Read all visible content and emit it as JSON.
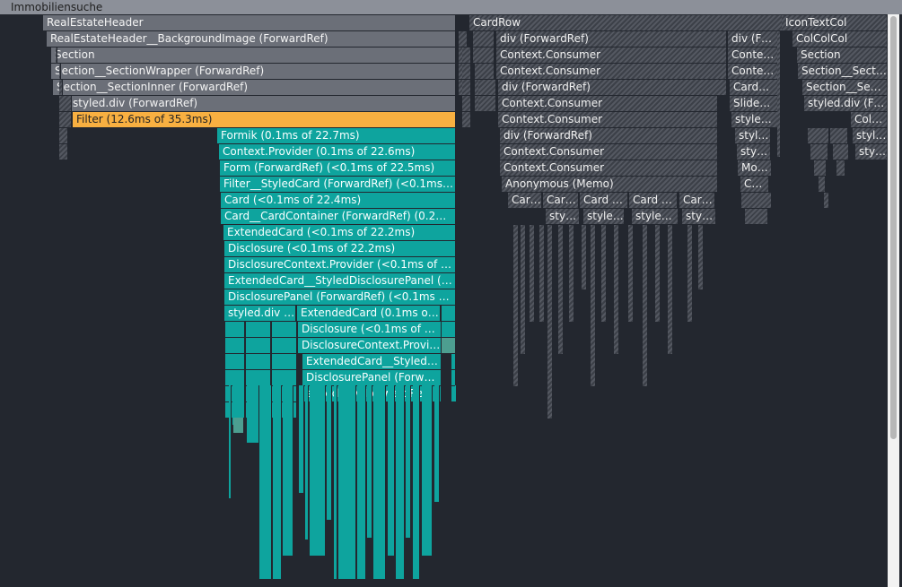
{
  "root": {
    "label": "Immobiliensuche"
  },
  "colors": {
    "selected": "#f8b041",
    "render": "#0ea49e",
    "inactive": "#6b6f78",
    "background": "#23272f"
  },
  "left_stack": [
    {
      "label": "RealEstateHeader"
    },
    {
      "label": "RealEstateHeader__BackgroundImage (ForwardRef)"
    },
    {
      "label": "Section"
    },
    {
      "label": "Section__SectionWrapper (ForwardRef)"
    },
    {
      "label": "Section__SectionInner (ForwardRef)"
    },
    {
      "label": "styled.div (ForwardRef)"
    },
    {
      "label": "Filter (12.6ms of 35.3ms)"
    }
  ],
  "render_stack": [
    {
      "label": "Formik (0.1ms of 22.7ms)"
    },
    {
      "label": "Context.Provider (0.1ms of 22.6ms)"
    },
    {
      "label": "Form (ForwardRef) (<0.1ms of 22.5ms)"
    },
    {
      "label": "Filter__StyledCard (ForwardRef) (<0.1ms of…"
    },
    {
      "label": "Card (<0.1ms of 22.4ms)"
    },
    {
      "label": "Card__CardContainer (ForwardRef) (0.2ms…"
    },
    {
      "label": "ExtendedCard (<0.1ms of 22.2ms)"
    },
    {
      "label": "Disclosure (<0.1ms of 22.2ms)"
    },
    {
      "label": "DisclosureContext.Provider (<0.1ms of 22.…"
    },
    {
      "label": "ExtendedCard__StyledDisclosurePanel (F…"
    },
    {
      "label": "DisclosurePanel (ForwardRef) (<0.1ms of …"
    }
  ],
  "split_row": [
    {
      "label": "styled.div …"
    },
    {
      "label": "ExtendedCard (0.1ms of …"
    }
  ],
  "sub_stack": [
    {
      "label": "Disclosure (<0.1ms of 13.…"
    },
    {
      "label": "DisclosureContext.Provi…"
    },
    {
      "label": "ExtendedCard__Styled…"
    },
    {
      "label": "DisclosurePanel (Forwa…"
    },
    {
      "label": "styled.div (ForwardRef) …"
    }
  ],
  "cardrow": [
    {
      "label": "CardRow"
    },
    {
      "label": "div (ForwardRef)"
    },
    {
      "label": "Context.Consumer"
    },
    {
      "label": "Context.Consumer"
    },
    {
      "label": "div (ForwardRef)"
    },
    {
      "label": "Context.Consumer"
    },
    {
      "label": "Context.Consumer"
    },
    {
      "label": "div (ForwardRef)"
    },
    {
      "label": "Context.Consumer"
    },
    {
      "label": "Context.Consumer"
    },
    {
      "label": "Anonymous (Memo)"
    }
  ],
  "card_children": [
    {
      "label": "Car…"
    },
    {
      "label": "Car…"
    },
    {
      "label": "Card k…"
    },
    {
      "label": "Card k…"
    },
    {
      "label": "Car…"
    }
  ],
  "card_grandchildren": [
    {
      "label": "styl…"
    },
    {
      "label": "style…"
    },
    {
      "label": "styled…"
    },
    {
      "label": "styl…"
    }
  ],
  "right_col": [
    {
      "label": "div (Fo…"
    },
    {
      "label": "Contex…"
    },
    {
      "label": "Contex…"
    },
    {
      "label": "Card…"
    },
    {
      "label": "Slide…"
    },
    {
      "label": "style…"
    },
    {
      "label": "styl…"
    },
    {
      "label": "styl…"
    },
    {
      "label": "Mot…"
    },
    {
      "label": "Co…"
    }
  ],
  "icon_col": [
    {
      "label": "IconTextCol"
    },
    {
      "label": "ColColCol"
    },
    {
      "label": "Section"
    },
    {
      "label": "Section__Secti…"
    },
    {
      "label": "Section__Secti…"
    },
    {
      "label": "styled.div (For…"
    },
    {
      "label": "ColC…"
    },
    {
      "label": "style…"
    },
    {
      "label": "sty…"
    }
  ]
}
